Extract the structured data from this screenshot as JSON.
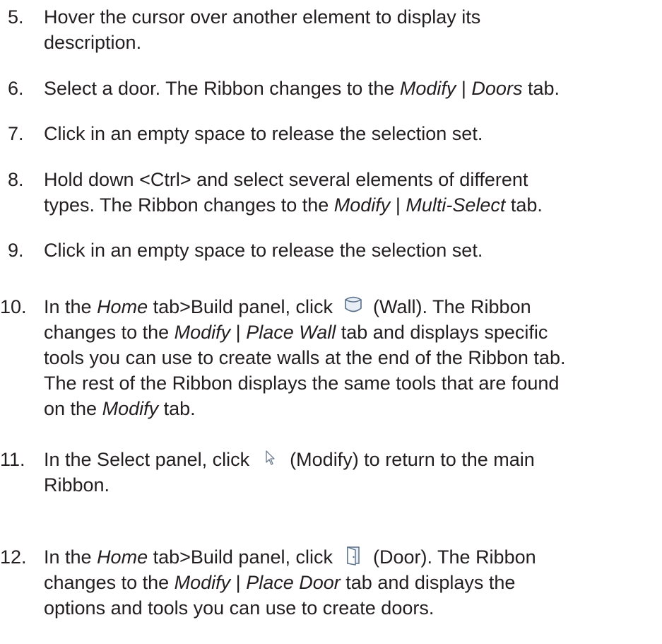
{
  "steps": [
    {
      "number": "5.",
      "lines": [
        [
          "Hover the cursor over another element to display its"
        ],
        [
          "description."
        ]
      ]
    },
    {
      "number": "6.",
      "lines": [
        [
          "Select a door. The Ribbon changes to the ",
          "Modify",
          " | ",
          "Doors",
          " tab."
        ]
      ]
    },
    {
      "number": "7.",
      "lines": [
        [
          "Click in an empty space to release the selection set."
        ]
      ]
    },
    {
      "number": "8.",
      "lines": [
        [
          "Hold down <Ctrl> and select several elements of different"
        ],
        [
          "types. The Ribbon changes to the ",
          "Modify",
          " | ",
          "Multi-Select",
          " tab."
        ]
      ]
    },
    {
      "number": "9.",
      "lines": [
        [
          "Click in an empty space to release the selection set."
        ]
      ]
    },
    {
      "number": "10.",
      "line1_a": "In the ",
      "line1_b": "Home",
      "line1_c": " tab>Build panel, click ",
      "icon": "wall-icon",
      "line1_d": " (Wall). The Ribbon",
      "line2_a": "changes to the ",
      "line2_b": "Modify",
      "line2_c": " | ",
      "line2_d": "Place Wall",
      "line2_e": " tab and displays specific",
      "line3": "tools you can use to create walls at the end of the Ribbon tab.",
      "line4": "The rest of the Ribbon displays the same tools that are found",
      "line5_a": "on the ",
      "line5_b": "Modify",
      "line5_c": " tab."
    },
    {
      "number": "11.",
      "line1_a": "In the Select panel, click ",
      "icon": "cursor-arrow-icon",
      "line1_b": " (Modify) to return to the main",
      "line2": "Ribbon."
    },
    {
      "number": "12.",
      "line1_a": "In the ",
      "line1_b": "Home",
      "line1_c": " tab>Build panel, click ",
      "icon": "door-icon",
      "line1_d": " (Door). The Ribbon",
      "line2_a": "changes to the ",
      "line2_b": "Modify",
      "line2_c": " | ",
      "line2_d": "Place Door",
      "line2_e": " tab and displays the",
      "line3": "options and tools you can use to create doors."
    }
  ],
  "colors": {
    "text": "#231f20",
    "icon_stroke": "#5a6f8a",
    "icon_fill": "#e8eef5"
  }
}
